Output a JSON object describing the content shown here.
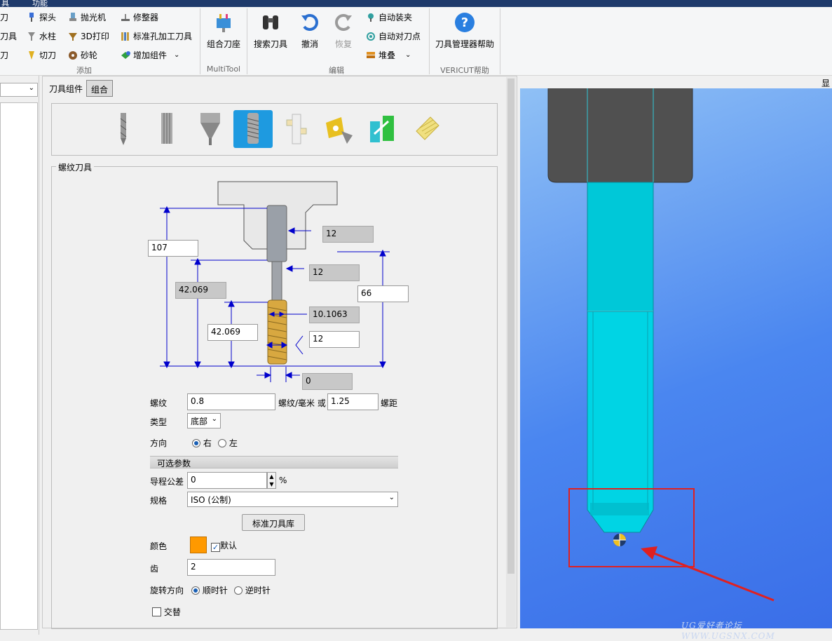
{
  "titlebar": {
    "left_fragment": "具",
    "right_fragment": "功能"
  },
  "ribbon": {
    "add": {
      "col1": [
        "刀",
        "刀具",
        "刀"
      ],
      "col2": [
        "探头",
        "水柱",
        "切刀"
      ],
      "col3": [
        "抛光机",
        "3D打印",
        "砂轮"
      ],
      "col4": [
        "修整器",
        "标准孔加工刀具",
        "增加组件"
      ],
      "label": "添加"
    },
    "multitool": {
      "button": "组合刀座",
      "label": "MultiTool"
    },
    "edit": {
      "search": "搜索刀具",
      "undo": "撤消",
      "redo": "恢复",
      "auto_clamp": "自动装夹",
      "auto_set": "自动对刀点",
      "stack": "堆叠",
      "label": "编辑"
    },
    "help": {
      "button": "刀具管理器帮助",
      "label": "VERICUT帮助"
    }
  },
  "tabs": {
    "component": "刀具组件",
    "assembly": "组合"
  },
  "right_label": "显",
  "thread": {
    "group_title": "螺纹刀具",
    "dims": {
      "overall": "107",
      "top_dia": "12",
      "shank_dia": "12",
      "length2": "42.069",
      "length3": "42.069",
      "height": "66",
      "thread_dia": "10.1063",
      "tip": "12",
      "bottom": "0"
    },
    "pitch_label": "螺纹",
    "pitch_value": "0.8",
    "per_mm_or": "螺纹/毫米 或",
    "pitch2_value": "1.25",
    "pitch2_label": "螺距",
    "type_label": "类型",
    "type_value": "底部",
    "dir_label": "方向",
    "dir_right": "右",
    "dir_left": "左",
    "optional_header": "可选参数",
    "lead_tol_label": "导程公差",
    "lead_tol_value": "0",
    "percent": "%",
    "spec_label": "规格",
    "spec_value": "ISO (公制)",
    "std_lib_button": "标准刀具库",
    "color_label": "颜色",
    "color_hex": "#ff9900",
    "default_label": "默认",
    "teeth_label": "齿",
    "teeth_value": "2",
    "rotation_label": "旋转方向",
    "rot_cw": "顺时针",
    "rot_ccw": "逆时针",
    "alternate_label": "交替"
  },
  "watermark": "UG爱好者论坛 WWW.UGSNX.COM",
  "colors": {
    "tool_body": "#00c8d8",
    "holder": "#555555",
    "highlight": "#e02020",
    "selected_type": "#1e9ae0"
  }
}
